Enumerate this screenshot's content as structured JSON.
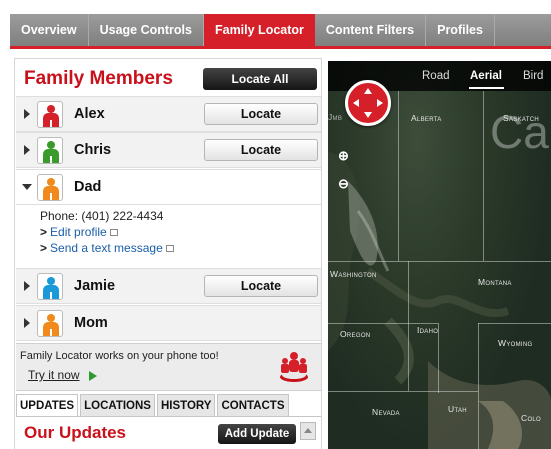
{
  "nav": {
    "tabs": [
      {
        "label": "Overview"
      },
      {
        "label": "Usage Controls"
      },
      {
        "label": "Family Locator"
      },
      {
        "label": "Content Filters"
      },
      {
        "label": "Profiles"
      }
    ],
    "active_tab": "Family Locator",
    "accent_color": "#d5202a"
  },
  "family": {
    "title": "Family Members",
    "locate_all": "Locate All",
    "members": [
      {
        "name": "Alex",
        "locate": "Locate",
        "color": "#d5202a",
        "expanded": false
      },
      {
        "name": "Chris",
        "locate": "Locate",
        "color": "#3a9a2b",
        "expanded": false
      },
      {
        "name": "Dad",
        "color": "#f08a1c",
        "expanded": true
      },
      {
        "name": "Jamie",
        "locate": "Locate",
        "color": "#1a9ad8",
        "expanded": false
      },
      {
        "name": "Mom",
        "color": "#f08a1c",
        "expanded": false
      }
    ],
    "dad_details": {
      "phone": "Phone: (401) 222-4434",
      "edit_profile": "Edit profile",
      "send_text": "Send a text message"
    }
  },
  "promo": {
    "text": "Family Locator works on your phone too!",
    "try_link": "Try it now"
  },
  "subtabs": [
    {
      "label": "UPDATES"
    },
    {
      "label": "LOCATIONS"
    },
    {
      "label": "HISTORY"
    },
    {
      "label": "CONTACTS"
    }
  ],
  "updates": {
    "title": "Our Updates",
    "add_update": "Add Update"
  },
  "map": {
    "view_tabs": [
      {
        "label": "Road"
      },
      {
        "label": "Aerial"
      },
      {
        "label": "Bird"
      }
    ],
    "active_view": "Aerial",
    "zoom_in": "⊕",
    "zoom_out": "⊖",
    "big_label": "Ca",
    "place_labels": [
      "Alberta",
      "Saskatch",
      "Washington",
      "Montana",
      "Oregon",
      "Idaho",
      "Wyoming",
      "Nevada",
      "Utah",
      "Colo",
      "Jmb"
    ]
  }
}
